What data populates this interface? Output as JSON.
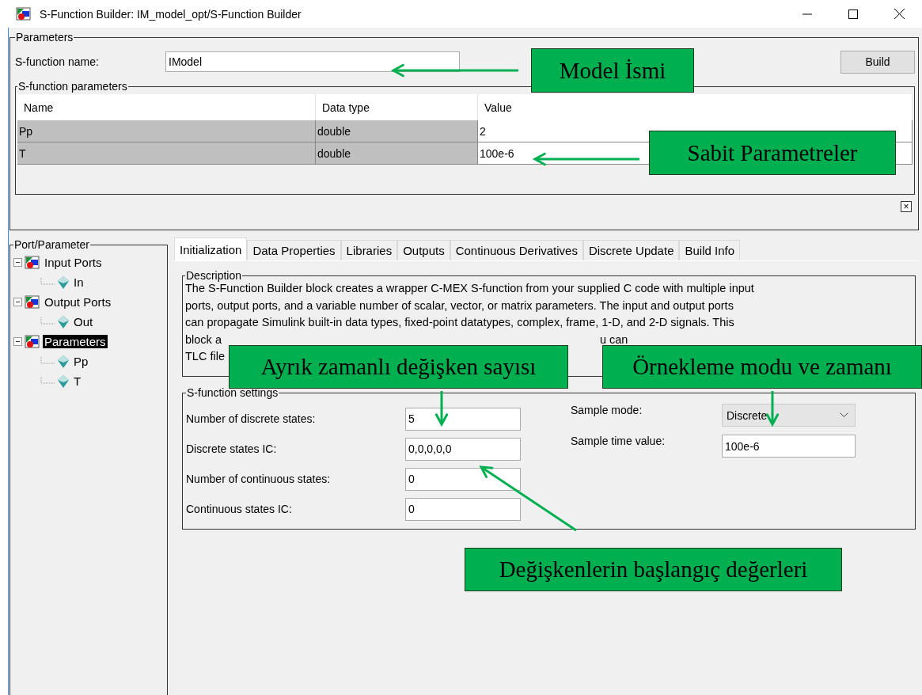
{
  "window": {
    "title": "S-Function Builder: IM_model_opt/S-Function Builder"
  },
  "parameters": {
    "title": "Parameters",
    "name_label": "S-function name:",
    "name_value": "IModel",
    "build_button": "Build",
    "table_title": "S-function parameters",
    "columns": [
      "Name",
      "Data type",
      "Value"
    ],
    "rows": [
      {
        "name": "Pp",
        "type": "double",
        "value": "2"
      },
      {
        "name": "T",
        "type": "double",
        "value": "100e-6"
      }
    ],
    "close_button": "×"
  },
  "tree": {
    "title": "Port/Parameter",
    "items": [
      {
        "label": "Input Ports",
        "kind": "group",
        "expanded": true,
        "selected": false,
        "children": [
          {
            "label": "In",
            "kind": "port",
            "selected": false
          }
        ]
      },
      {
        "label": "Output Ports",
        "kind": "group",
        "expanded": true,
        "selected": false,
        "children": [
          {
            "label": "Out",
            "kind": "port",
            "selected": false
          }
        ]
      },
      {
        "label": "Parameters",
        "kind": "group",
        "expanded": true,
        "selected": true,
        "children": [
          {
            "label": "Pp",
            "kind": "port",
            "selected": false
          },
          {
            "label": "T",
            "kind": "port",
            "selected": false
          }
        ]
      }
    ]
  },
  "tabs": [
    {
      "label": "Initialization",
      "selected": true
    },
    {
      "label": "Data Properties",
      "selected": false
    },
    {
      "label": "Libraries",
      "selected": false
    },
    {
      "label": "Outputs",
      "selected": false
    },
    {
      "label": "Continuous Derivatives",
      "selected": false
    },
    {
      "label": "Discrete Update",
      "selected": false
    },
    {
      "label": "Build Info",
      "selected": false
    }
  ],
  "description": {
    "title": "Description",
    "lines": [
      {
        "text": "The S-Function Builder block creates a wrapper C-MEX S-function from your supplied C code with multiple input"
      },
      {
        "text": "ports, output ports, and a variable number of scalar, vector, or matrix parameters. The input and output ports"
      },
      {
        "text": "can propagate Simulink built-in data types, fixed-point datatypes, complex, frame, 1-D, and 2-D signals. This"
      },
      {
        "text": "block a",
        "tail": "u can"
      },
      {
        "text": "TLC file"
      }
    ]
  },
  "settings": {
    "title": "S-function settings",
    "left": [
      {
        "label": "Number of discrete states:",
        "value": "5"
      },
      {
        "label": "Discrete states IC:",
        "value": "0,0,0,0,0"
      },
      {
        "label": "Number of continuous states:",
        "value": "0"
      },
      {
        "label": "Continuous states IC:",
        "value": "0"
      }
    ],
    "right": [
      {
        "label": "Sample mode:",
        "value": "Discrete",
        "kind": "dropdown"
      },
      {
        "label": "Sample time value:",
        "value": "100e-6",
        "kind": "text"
      }
    ]
  },
  "annotations": [
    {
      "text": "Model İsmi"
    },
    {
      "text": "Sabit Parametreler"
    },
    {
      "text": "Ayrık zamanlı değişken sayısı"
    },
    {
      "text": "Örnekleme modu ve zamanı"
    },
    {
      "text": "Değişkenlerin başlangıç değerleri"
    }
  ]
}
